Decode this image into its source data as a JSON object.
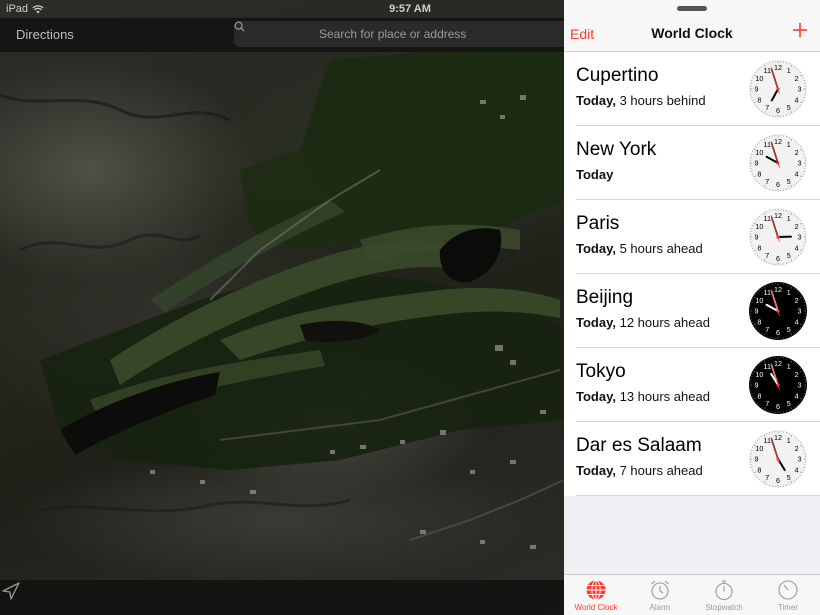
{
  "status_bar": {
    "carrier": "iPad",
    "time": "9:57 AM"
  },
  "maps": {
    "directions_label": "Directions",
    "search_placeholder": "Search for place or address"
  },
  "world_clock": {
    "edit_label": "Edit",
    "title": "World Clock",
    "clocks": [
      {
        "city": "Cupertino",
        "day": "Today,",
        "offset": "3 hours behind",
        "hour": 6,
        "minute": 57,
        "face": "light"
      },
      {
        "city": "New York",
        "day": "Today",
        "offset": "",
        "hour": 9,
        "minute": 57,
        "face": "light"
      },
      {
        "city": "Paris",
        "day": "Today,",
        "offset": "5 hours ahead",
        "hour": 2,
        "minute": 57,
        "face": "light"
      },
      {
        "city": "Beijing",
        "day": "Today,",
        "offset": "12 hours ahead",
        "hour": 9,
        "minute": 57,
        "face": "dark"
      },
      {
        "city": "Tokyo",
        "day": "Today,",
        "offset": "13 hours ahead",
        "hour": 10,
        "minute": 57,
        "face": "dark"
      },
      {
        "city": "Dar es Salaam",
        "day": "Today,",
        "offset": "7 hours ahead",
        "hour": 4,
        "minute": 57,
        "face": "light"
      }
    ],
    "tabs": [
      {
        "label": "World Clock",
        "icon": "globe-icon",
        "active": true
      },
      {
        "label": "Alarm",
        "icon": "alarm-icon",
        "active": false
      },
      {
        "label": "Stopwatch",
        "icon": "stopwatch-icon",
        "active": false
      },
      {
        "label": "Timer",
        "icon": "timer-icon",
        "active": false
      }
    ]
  },
  "colors": {
    "accent": "#ff3b30",
    "dark_face": "#000000",
    "light_face": "#f2f2f2"
  }
}
